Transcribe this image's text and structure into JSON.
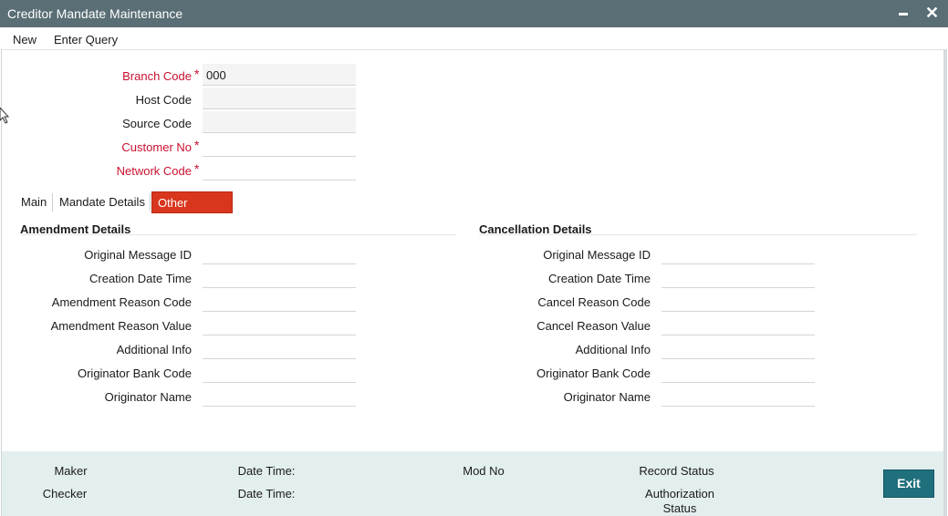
{
  "window": {
    "title": "Creditor Mandate Maintenance"
  },
  "menu": {
    "new": "New",
    "enter_query": "Enter Query"
  },
  "header_fields": {
    "branch_code": {
      "label": "Branch Code",
      "value": "000"
    },
    "host_code": {
      "label": "Host Code",
      "value": ""
    },
    "source_code": {
      "label": "Source Code",
      "value": ""
    },
    "customer_no": {
      "label": "Customer No",
      "value": ""
    },
    "network_code": {
      "label": "Network Code",
      "value": ""
    },
    "required_mark": "*"
  },
  "tabs": [
    "Main",
    "Mandate Details",
    "Other Details"
  ],
  "amendment": {
    "title": "Amendment Details",
    "fields": [
      "Original Message ID",
      "Creation Date Time",
      "Amendment Reason Code",
      "Amendment Reason Value",
      "Additional Info",
      "Originator Bank Code",
      "Originator Name"
    ]
  },
  "cancellation": {
    "title": "Cancellation Details",
    "fields": [
      "Original Message ID",
      "Creation Date Time",
      "Cancel Reason Code",
      "Cancel Reason Value",
      "Additional Info",
      "Originator Bank Code",
      "Originator Name"
    ]
  },
  "footer": {
    "maker": "Maker",
    "checker": "Checker",
    "date_time_1": "Date Time:",
    "date_time_2": "Date Time:",
    "mod_no": "Mod No",
    "record_status": "Record Status",
    "authorization_status": "Authorization Status",
    "exit": "Exit"
  },
  "colors": {
    "titlebar": "#5a6e75",
    "active_tab": "#d9361e",
    "required": "#c8102e",
    "footer": "#e3eeef",
    "exit_button": "#1f6f7c"
  }
}
